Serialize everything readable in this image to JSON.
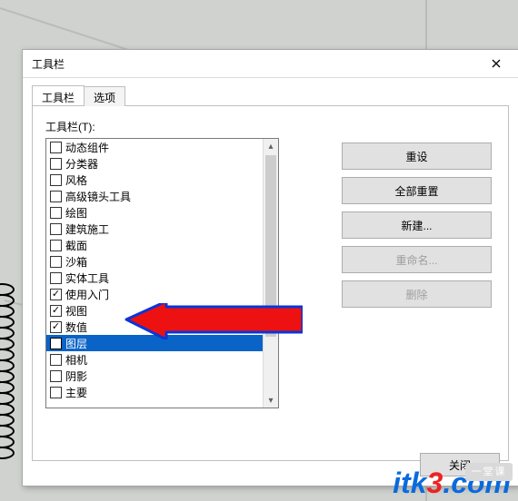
{
  "dialog": {
    "title": "工具栏",
    "tabs": [
      {
        "label": "工具栏",
        "active": true
      },
      {
        "label": "选项",
        "active": false
      }
    ],
    "list_label": "工具栏(T):",
    "items": [
      {
        "label": "动态组件",
        "checked": false,
        "selected": false
      },
      {
        "label": "分类器",
        "checked": false,
        "selected": false
      },
      {
        "label": "风格",
        "checked": false,
        "selected": false
      },
      {
        "label": "高级镜头工具",
        "checked": false,
        "selected": false
      },
      {
        "label": "绘图",
        "checked": false,
        "selected": false
      },
      {
        "label": "建筑施工",
        "checked": false,
        "selected": false
      },
      {
        "label": "截面",
        "checked": false,
        "selected": false
      },
      {
        "label": "沙箱",
        "checked": false,
        "selected": false
      },
      {
        "label": "实体工具",
        "checked": false,
        "selected": false
      },
      {
        "label": "使用入门",
        "checked": true,
        "selected": false
      },
      {
        "label": "视图",
        "checked": true,
        "selected": false
      },
      {
        "label": "数值",
        "checked": true,
        "selected": false
      },
      {
        "label": "图层",
        "checked": false,
        "selected": true
      },
      {
        "label": "相机",
        "checked": false,
        "selected": false
      },
      {
        "label": "阴影",
        "checked": false,
        "selected": false
      },
      {
        "label": "主要",
        "checked": false,
        "selected": false
      }
    ],
    "buttons": {
      "reset": {
        "label": "重设",
        "enabled": true
      },
      "reset_all": {
        "label": "全部重置",
        "enabled": true
      },
      "new": {
        "label": "新建...",
        "enabled": true
      },
      "rename": {
        "label": "重命名...",
        "enabled": false
      },
      "delete": {
        "label": "删除",
        "enabled": false
      }
    },
    "close_button": "关闭"
  },
  "watermark": {
    "text_a": "itk",
    "text_b": "3",
    "text_c": ".",
    "text_d": "com",
    "badge": "一堂课"
  }
}
